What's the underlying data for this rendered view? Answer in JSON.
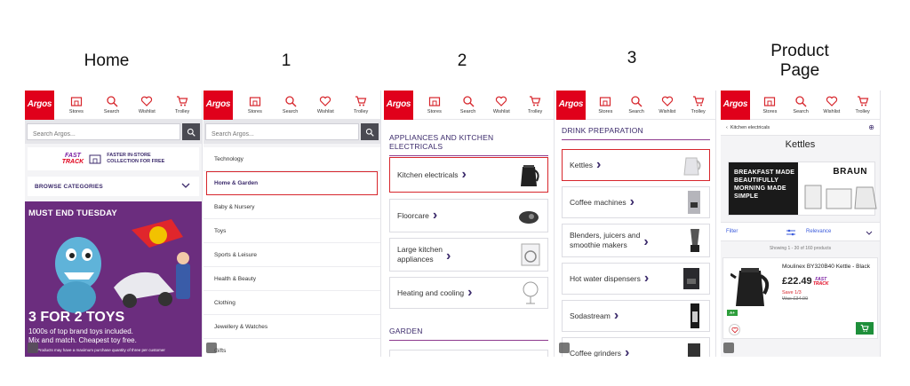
{
  "column_titles": [
    "Home",
    "1",
    "2",
    "3",
    "Product\nPage"
  ],
  "app": {
    "logo": "Argos",
    "nav": [
      "Stores",
      "Search",
      "Wishlist",
      "Trolley"
    ],
    "search_placeholder": "Search Argos...",
    "brand_red": "#e0001b",
    "accent_purple": "#3b2a6b"
  },
  "home": {
    "fasttrack_line1": "FAST",
    "fasttrack_line2": "TRACK",
    "fasttrack_text1": "FASTER IN-STORE",
    "fasttrack_text2": "COLLECTION FOR FREE",
    "browse_label": "BROWSE CATEGORIES",
    "promo_tag": "MUST END TUESDAY",
    "promo_headline": "3 FOR 2 TOYS",
    "promo_sub1": "1000s of top brand toys included.",
    "promo_sub2": "Mix and match. Cheapest toy free.",
    "promo_fine": "Products may have a maximum purchase quantity of three per customer"
  },
  "screen1": {
    "categories": [
      "Technology",
      "Home & Garden",
      "Baby & Nursery",
      "Toys",
      "Sports & Leisure",
      "Health & Beauty",
      "Clothing",
      "Jewellery & Watches",
      "Gifts"
    ],
    "active_index": 1
  },
  "screen2": {
    "section1": "APPLIANCES AND KITCHEN ELECTRICALS",
    "items": [
      "Kitchen electricals",
      "Floorcare",
      "Large kitchen\nappliances",
      "Heating and cooling"
    ],
    "section2": "GARDEN"
  },
  "screen3": {
    "section": "DRINK PREPARATION",
    "items": [
      "Kettles",
      "Coffee machines",
      "Blenders, juicers and\nsmoothie makers",
      "Hot water dispensers",
      "Sodastream",
      "Coffee grinders"
    ]
  },
  "product_page": {
    "breadcrumb": "Kitchen electricals",
    "title": "Kettles",
    "banner_text": "BREAKFAST MADE\nBEAUTIFULLY\nMORNING MADE\nSIMPLE",
    "banner_brand": "BRAUN",
    "filter_label": "Filter",
    "sort_label": "Relevance",
    "showing": "Showing 1 - 30 of 160 products",
    "product_name": "Moulinex BY320B40 Kettle - Black",
    "price": "£22.49",
    "save": "Save 1/3",
    "was": "Was £34.99",
    "energy": "A+"
  }
}
